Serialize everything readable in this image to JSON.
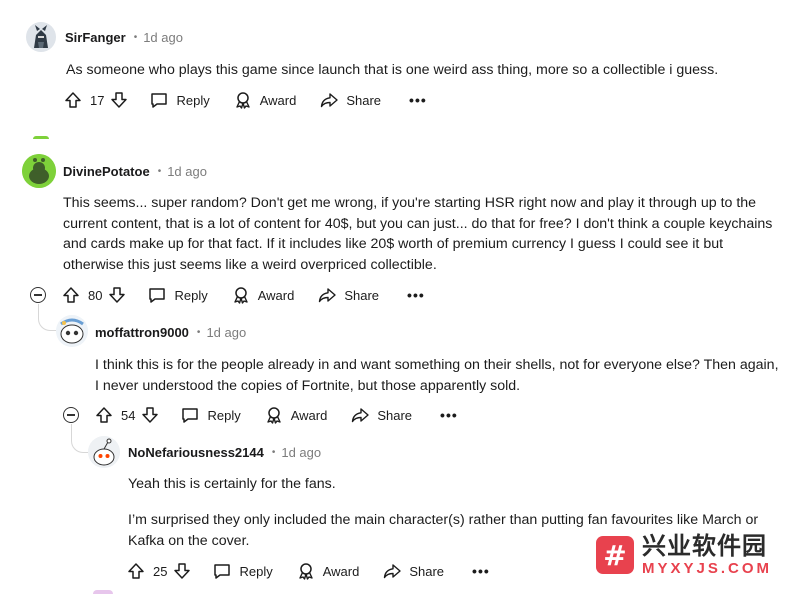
{
  "labels": {
    "reply": "Reply",
    "award": "Award",
    "share": "Share",
    "more": "•••"
  },
  "comments": [
    {
      "username": "SirFanger",
      "time": "1d ago",
      "lines": [
        "As someone who plays this game since launch that is one weird ass thing, more so a collectible i guess."
      ],
      "votes": "17",
      "avatar_color": "#2f3a45"
    },
    {
      "username": "DivinePotatoe",
      "time": "1d ago",
      "lines": [
        "This seems... super random? Don't get me wrong, if you're starting HSR right now and play it through up to the",
        "current content, that is a lot of content for 40$, but you can just... do that for free? I don't think a couple keychains",
        "and cards make up for that fact. If it includes like 20$ worth of premium currency I guess I could see it but",
        "otherwise this just seems like a weird overpriced collectible."
      ],
      "votes": "80",
      "avatar_color": "#7ed13a"
    },
    {
      "username": "moffattron9000",
      "time": "1d ago",
      "lines": [
        "I think this is for the people already in and want something on their shells, not for everyone else? Then again,",
        "I never understood the copies of Fortnite, but those apparently sold."
      ],
      "votes": "54",
      "avatar_color": "#6a9fd4"
    },
    {
      "username": "NoNefariousness2144",
      "time": "1d ago",
      "lines": [
        "Yeah this is certainly for the fans."
      ],
      "lines2": [
        "I’m surprised they only included the main character(s) rather than putting fan favourites like March or",
        "Kafka on the cover."
      ],
      "votes": "25",
      "avatar_color": "#ffffff"
    }
  ],
  "watermark": {
    "logo": "#",
    "cn": "兴业软件园",
    "en": "MYXYJS.COM"
  },
  "colors": {
    "meta_gray": "#7c7c7c",
    "thread_line": "#d7d7d7",
    "watermark_red": "#e8424e"
  }
}
